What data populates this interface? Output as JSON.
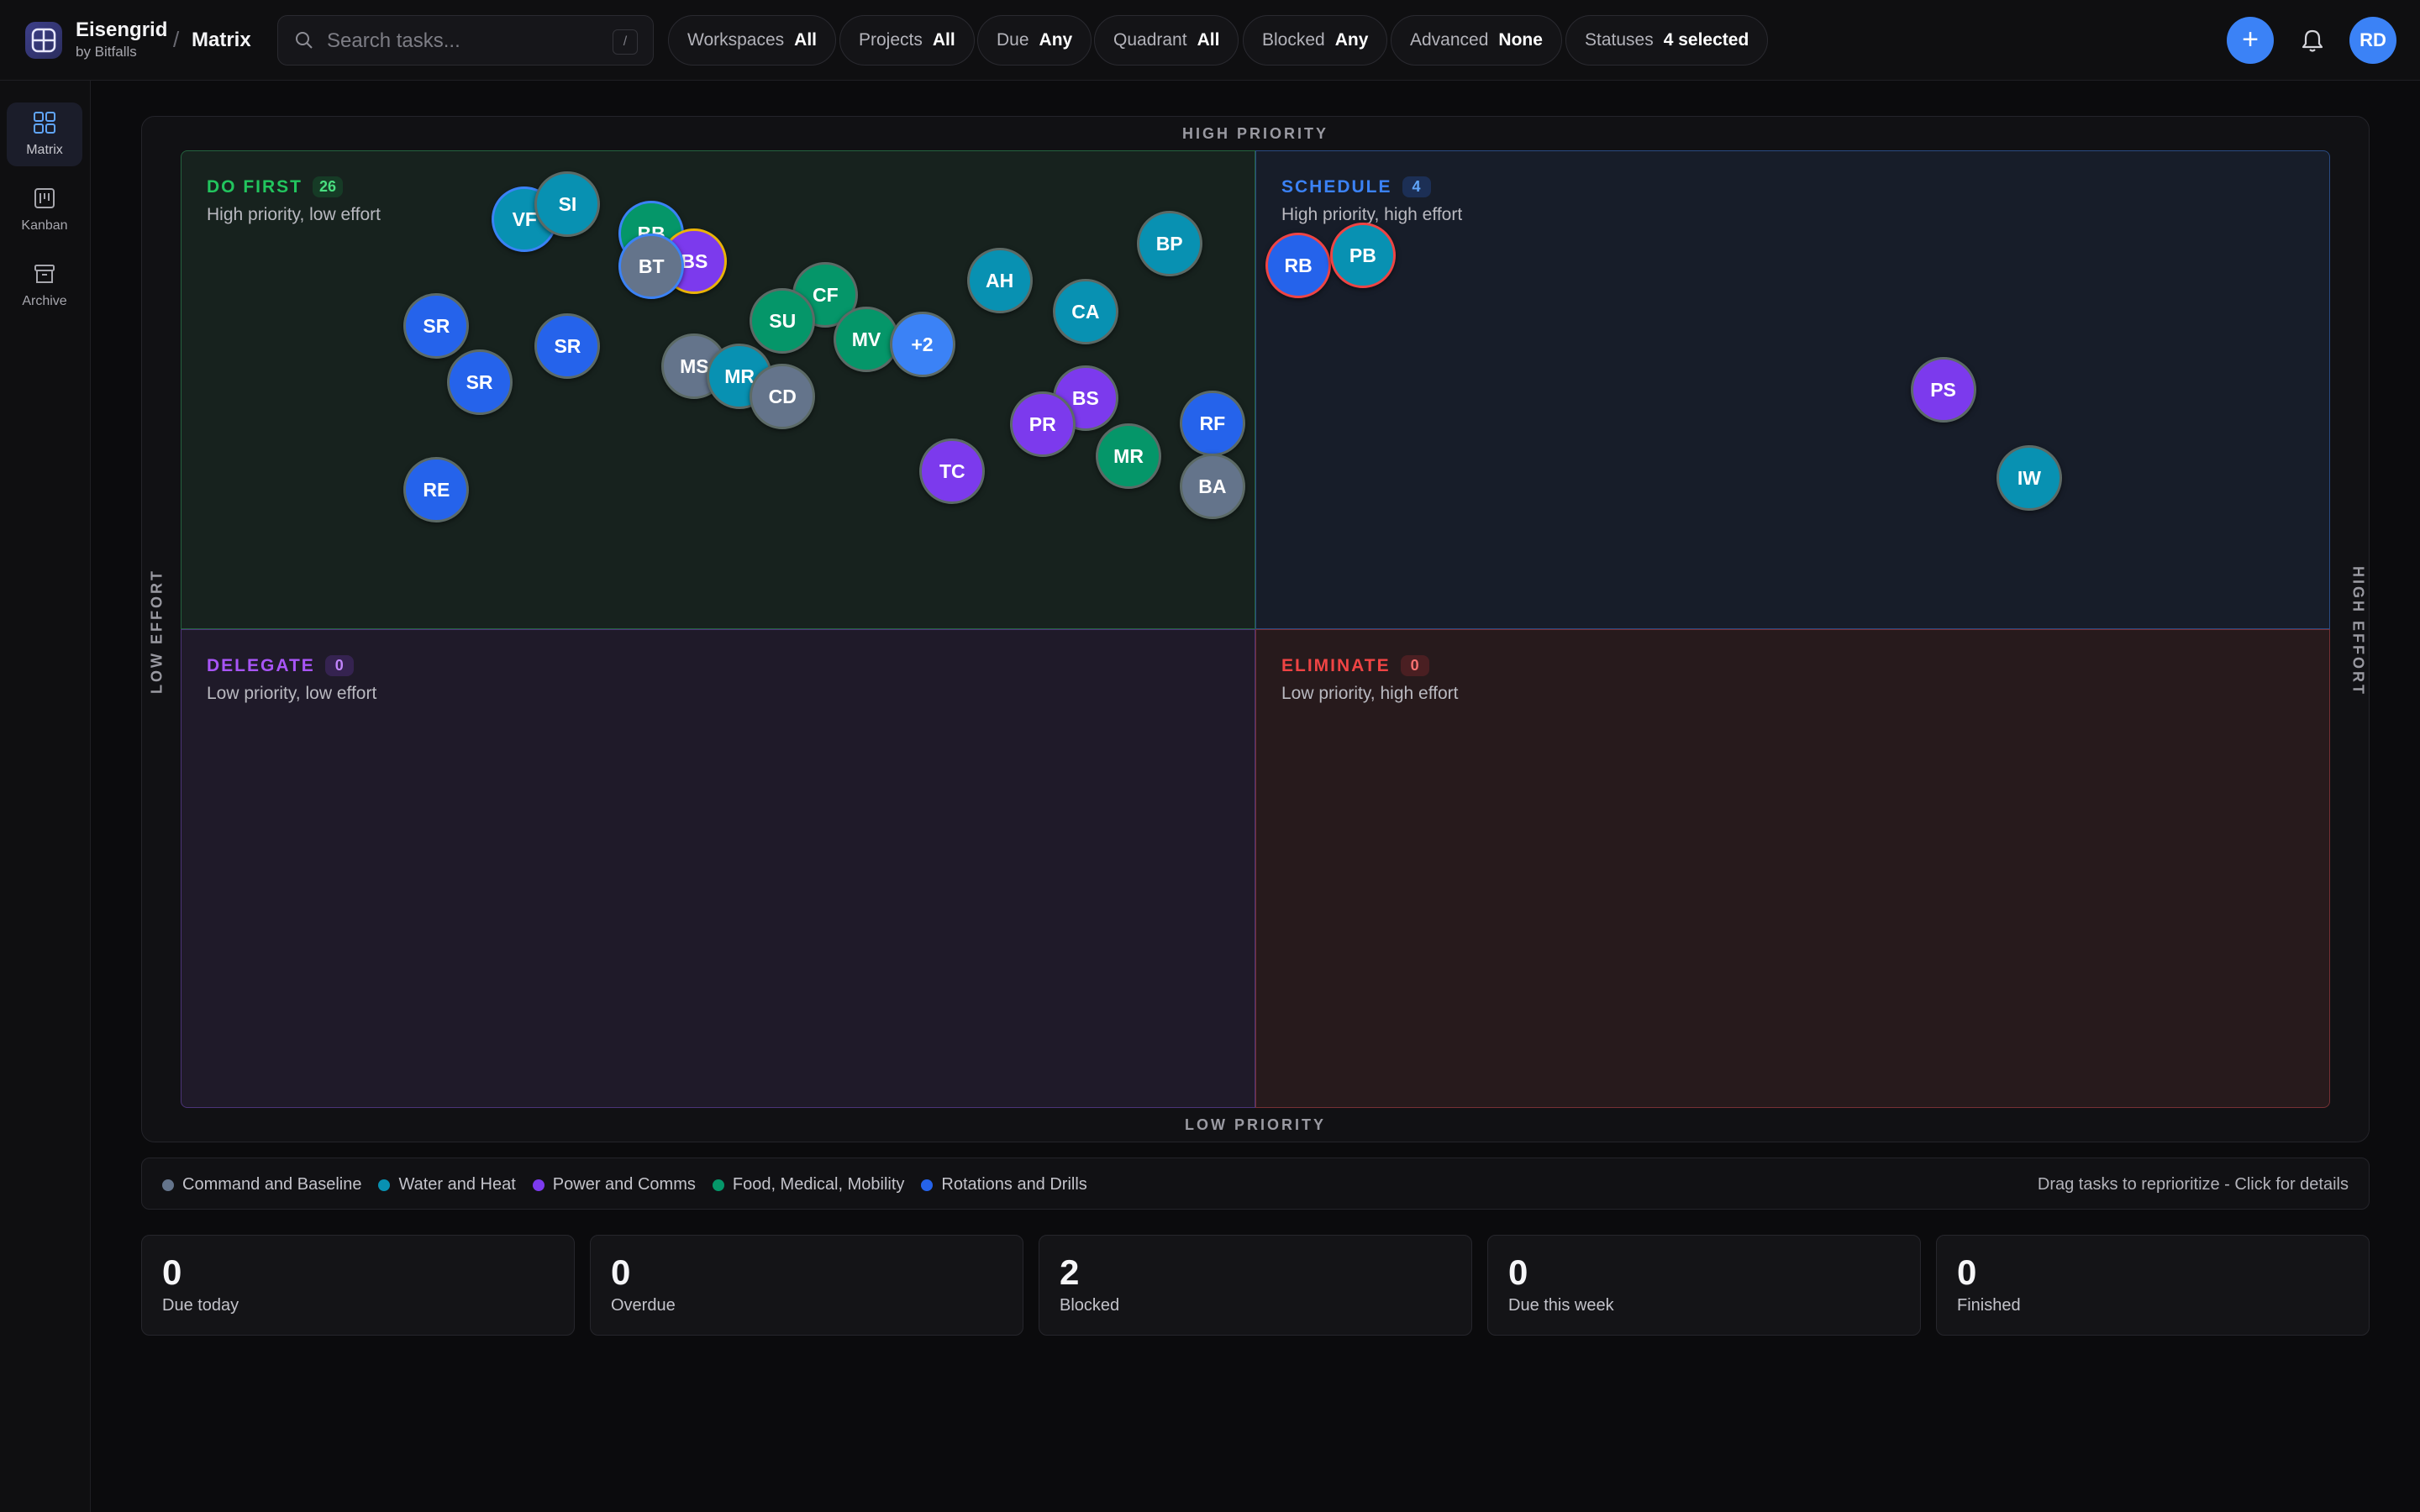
{
  "app": {
    "name": "Eisengrid",
    "subtitle": "by Bitfalls",
    "separator": "/",
    "current_view": "Matrix",
    "user_initials": "RD",
    "add_label": "+"
  },
  "search": {
    "placeholder": "Search tasks...",
    "value": "",
    "shortcut": "/"
  },
  "filters": [
    {
      "label": "Workspaces",
      "value": "All"
    },
    {
      "label": "Projects",
      "value": "All"
    },
    {
      "label": "Due",
      "value": "Any"
    },
    {
      "label": "Quadrant",
      "value": "All"
    },
    {
      "label": "Blocked",
      "value": "Any"
    },
    {
      "label": "Advanced",
      "value": "None"
    },
    {
      "label": "Statuses",
      "value": "4 selected"
    }
  ],
  "sidebar": {
    "items": [
      {
        "label": "Matrix",
        "icon": "grid-icon",
        "active": true
      },
      {
        "label": "Kanban",
        "icon": "kanban-icon",
        "active": false
      },
      {
        "label": "Archive",
        "icon": "archive-icon",
        "active": false
      }
    ]
  },
  "matrix": {
    "axes": {
      "top": "HIGH PRIORITY",
      "bottom": "LOW PRIORITY",
      "left": "LOW EFFORT",
      "right": "HIGH EFFORT"
    },
    "quadrants": {
      "do_first": {
        "title": "DO FIRST",
        "count": "26",
        "subtitle": "High priority, low effort",
        "color": "#22c55e"
      },
      "schedule": {
        "title": "SCHEDULE",
        "count": "4",
        "subtitle": "High priority, high effort",
        "color": "#3b82f6"
      },
      "delegate": {
        "title": "DELEGATE",
        "count": "0",
        "subtitle": "Low priority, low effort",
        "color": "#a855f7"
      },
      "eliminate": {
        "title": "ELIMINATE",
        "count": "0",
        "subtitle": "Low priority, high effort",
        "color": "#ef4444"
      }
    },
    "tasks": [
      {
        "initials": "VF",
        "effort": 0.16,
        "priority": 0.928,
        "color": "#0891b2",
        "ring": "#3b82f6"
      },
      {
        "initials": "SI",
        "effort": 0.18,
        "priority": 0.944,
        "color": "#0891b2",
        "ring": "#5c6a66"
      },
      {
        "initials": "BB",
        "effort": 0.219,
        "priority": 0.913,
        "color": "#059669",
        "ring": "#3b82f6"
      },
      {
        "initials": "BS",
        "effort": 0.239,
        "priority": 0.884,
        "color": "#7c3aed",
        "ring": "#eab308"
      },
      {
        "initials": "BT",
        "effort": 0.219,
        "priority": 0.879,
        "color": "#64748b",
        "ring": "#3b82f6"
      },
      {
        "initials": "BP",
        "effort": 0.46,
        "priority": 0.903,
        "color": "#0891b2",
        "ring": "#5c6a66"
      },
      {
        "initials": "AH",
        "effort": 0.381,
        "priority": 0.864,
        "color": "#0891b2",
        "ring": "#5c6a66"
      },
      {
        "initials": "CA",
        "effort": 0.421,
        "priority": 0.832,
        "color": "#0891b2",
        "ring": "#5c6a66"
      },
      {
        "initials": "CF",
        "effort": 0.3,
        "priority": 0.849,
        "color": "#059669",
        "ring": "#5c6a66"
      },
      {
        "initials": "SU",
        "effort": 0.28,
        "priority": 0.822,
        "color": "#059669",
        "ring": "#5c6a66"
      },
      {
        "initials": "MV",
        "effort": 0.319,
        "priority": 0.803,
        "color": "#059669",
        "ring": "#5c6a66"
      },
      {
        "initials": "+2",
        "effort": 0.345,
        "priority": 0.797,
        "color": "#3b82f6",
        "ring": "#5c6a66"
      },
      {
        "initials": "SR",
        "effort": 0.119,
        "priority": 0.817,
        "color": "#2563eb",
        "ring": "#5c6a66"
      },
      {
        "initials": "SR",
        "effort": 0.18,
        "priority": 0.796,
        "color": "#2563eb",
        "ring": "#5c6a66"
      },
      {
        "initials": "SR",
        "effort": 0.139,
        "priority": 0.758,
        "color": "#2563eb",
        "ring": "#5c6a66"
      },
      {
        "initials": "MS",
        "effort": 0.239,
        "priority": 0.775,
        "color": "#64748b",
        "ring": "#5c6a66"
      },
      {
        "initials": "MR",
        "effort": 0.26,
        "priority": 0.764,
        "color": "#0891b2",
        "ring": "#5c6a66"
      },
      {
        "initials": "CD",
        "effort": 0.28,
        "priority": 0.743,
        "color": "#64748b",
        "ring": "#5c6a66"
      },
      {
        "initials": "BS",
        "effort": 0.421,
        "priority": 0.741,
        "color": "#7c3aed",
        "ring": "#5c6a66"
      },
      {
        "initials": "RF",
        "effort": 0.48,
        "priority": 0.715,
        "color": "#2563eb",
        "ring": "#5c6a66"
      },
      {
        "initials": "PR",
        "effort": 0.401,
        "priority": 0.714,
        "color": "#7c3aed",
        "ring": "#5c6a66"
      },
      {
        "initials": "MR",
        "effort": 0.441,
        "priority": 0.681,
        "color": "#059669",
        "ring": "#5c6a66"
      },
      {
        "initials": "TC",
        "effort": 0.359,
        "priority": 0.665,
        "color": "#7c3aed",
        "ring": "#5c6a66"
      },
      {
        "initials": "BA",
        "effort": 0.48,
        "priority": 0.649,
        "color": "#64748b",
        "ring": "#5c6a66"
      },
      {
        "initials": "RE",
        "effort": 0.119,
        "priority": 0.646,
        "color": "#2563eb",
        "ring": "#5c6a66"
      },
      {
        "initials": "RB",
        "effort": 0.52,
        "priority": 0.88,
        "color": "#2563eb",
        "ring": "#ef4444"
      },
      {
        "initials": "PB",
        "effort": 0.55,
        "priority": 0.89,
        "color": "#0891b2",
        "ring": "#ef4444"
      },
      {
        "initials": "PS",
        "effort": 0.82,
        "priority": 0.75,
        "color": "#7c3aed",
        "ring": "#5c6a66"
      },
      {
        "initials": "IW",
        "effort": 0.86,
        "priority": 0.658,
        "color": "#0891b2",
        "ring": "#5c6a66"
      }
    ]
  },
  "legend": {
    "items": [
      {
        "label": "Command and Baseline",
        "color": "#64748b"
      },
      {
        "label": "Water and Heat",
        "color": "#0891b2"
      },
      {
        "label": "Power and Comms",
        "color": "#7c3aed"
      },
      {
        "label": "Food, Medical, Mobility",
        "color": "#059669"
      },
      {
        "label": "Rotations and Drills",
        "color": "#2563eb"
      }
    ],
    "hint": "Drag tasks to reprioritize - Click for details"
  },
  "stats": [
    {
      "value": "0",
      "label": "Due today"
    },
    {
      "value": "0",
      "label": "Overdue"
    },
    {
      "value": "2",
      "label": "Blocked"
    },
    {
      "value": "0",
      "label": "Due this week"
    },
    {
      "value": "0",
      "label": "Finished"
    }
  ]
}
